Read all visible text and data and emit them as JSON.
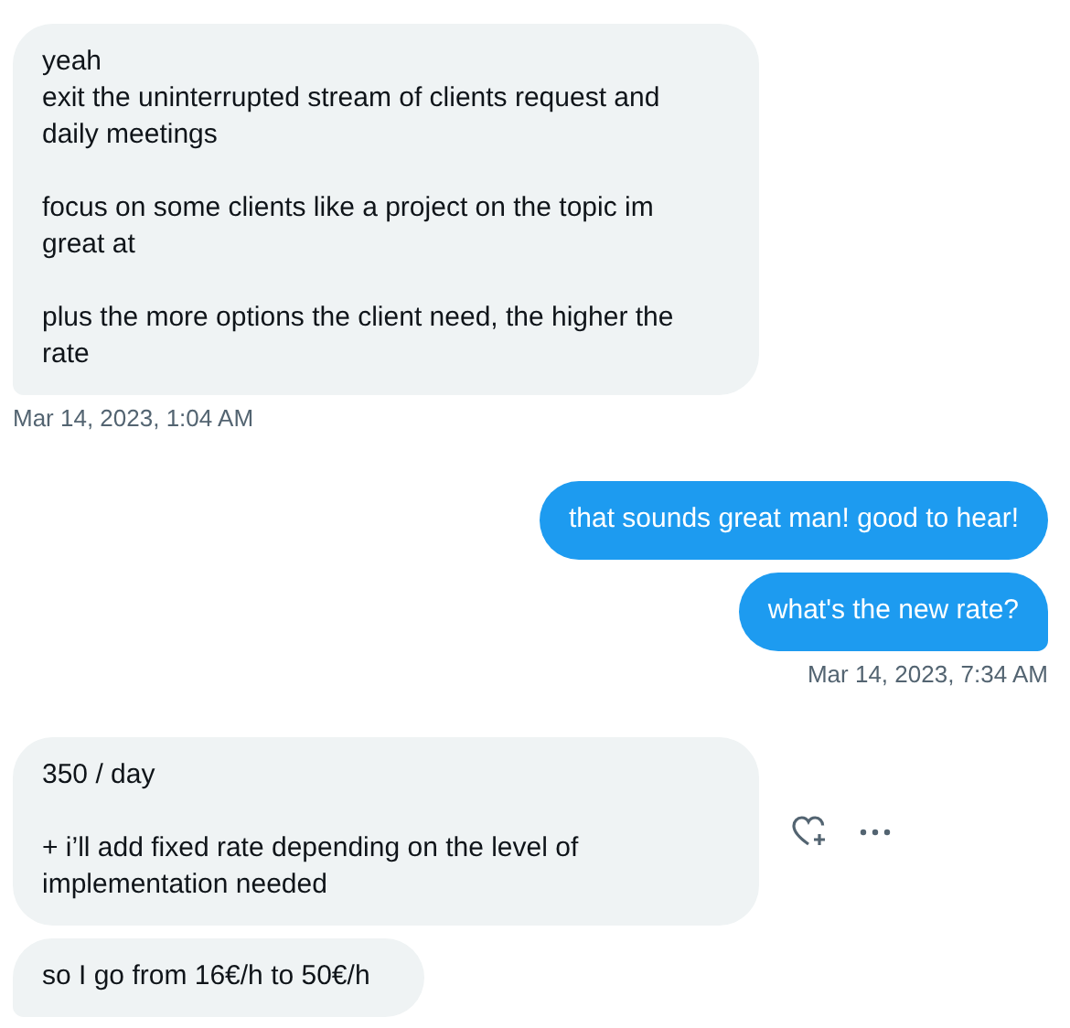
{
  "groups": [
    {
      "kind": "incoming",
      "bubbles": [
        {
          "text": "yeah\nexit the uninterrupted stream of clients request and daily meetings\n\nfocus on some clients like a project on the topic im great at\n\nplus the more options the client need, the higher the rate",
          "show_actions": false
        }
      ],
      "timestamp": "Mar 14, 2023, 1:04 AM"
    },
    {
      "kind": "outgoing",
      "bubbles": [
        {
          "text": "that sounds great man! good to hear!",
          "show_actions": false
        },
        {
          "text": "what's the new rate?",
          "show_actions": false
        }
      ],
      "timestamp": "Mar 14, 2023, 7:34 AM"
    },
    {
      "kind": "incoming",
      "bubbles": [
        {
          "text": "350 / day\n\n+ i’ll add fixed rate depending on the level of implementation needed",
          "show_actions": true
        },
        {
          "text": "so I go from 16€/h to 50€/h",
          "show_actions": false
        }
      ]
    }
  ]
}
